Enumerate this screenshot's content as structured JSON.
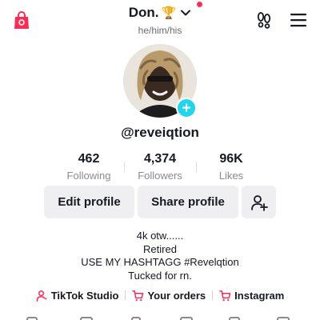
{
  "header": {
    "display_name": "Don.",
    "trophy_emoji": "🏆",
    "pronouns": "he/him/his",
    "icons": {
      "shop": "shopping-bag-icon",
      "footprint": "footprints-icon",
      "menu": "hamburger-menu-icon"
    },
    "notification_dot_color": "#fe2c55"
  },
  "profile": {
    "username": "@reveiqtion",
    "add_badge_symbol": "+",
    "add_badge_color": "#20d5ec"
  },
  "stats": [
    {
      "value": "462",
      "label": "Following"
    },
    {
      "value": "4,374",
      "label": "Followers"
    },
    {
      "value": "96K",
      "label": "Likes"
    }
  ],
  "actions": {
    "edit_label": "Edit profile",
    "share_label": "Share profile",
    "add_friend_icon": "add-friend-icon"
  },
  "bio": [
    "4k otw......",
    "Retired",
    "USE MY HASHTAGG #Revelqtion",
    "Tucked for rn."
  ],
  "links": [
    {
      "label": "TikTok Studio",
      "icon": "person-icon"
    },
    {
      "label": "Your orders",
      "icon": "cart-icon"
    },
    {
      "label": "Instagram",
      "icon": "cart-icon"
    }
  ],
  "colors": {
    "accent": "#fe2c55",
    "button_bg": "#efeff1",
    "secondary_text": "#8a8b91"
  }
}
